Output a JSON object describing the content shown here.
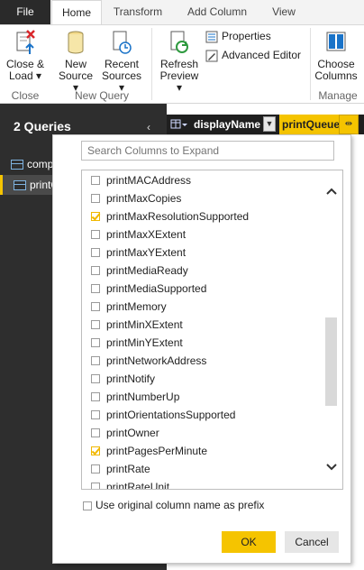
{
  "tabs": [
    "File",
    "Home",
    "Transform",
    "Add Column",
    "View"
  ],
  "ribbon": {
    "close_load": "Close &",
    "close_load2": "Load",
    "new_source": "New",
    "new_source2": "Source",
    "recent_sources": "Recent",
    "recent_sources2": "Sources",
    "refresh_preview": "Refresh",
    "refresh_preview2": "Preview",
    "properties": "Properties",
    "advanced_editor": "Advanced Editor",
    "choose_columns": "Choose",
    "choose_columns2": "Columns",
    "group_close": "Close",
    "group_new_query": "New Query",
    "group_manage": "Manage"
  },
  "queries": {
    "title": "2 Queries",
    "items": [
      "comp",
      "printQ"
    ]
  },
  "columns": {
    "display_name": "displayName",
    "print_queue": "printQueue"
  },
  "expand_panel": {
    "search_placeholder": "Search Columns to Expand",
    "items": [
      {
        "label": "printMACAddress",
        "checked": false
      },
      {
        "label": "printMaxCopies",
        "checked": false
      },
      {
        "label": "printMaxResolutionSupported",
        "checked": true
      },
      {
        "label": "printMaxXExtent",
        "checked": false
      },
      {
        "label": "printMaxYExtent",
        "checked": false
      },
      {
        "label": "printMediaReady",
        "checked": false
      },
      {
        "label": "printMediaSupported",
        "checked": false
      },
      {
        "label": "printMemory",
        "checked": false
      },
      {
        "label": "printMinXExtent",
        "checked": false
      },
      {
        "label": "printMinYExtent",
        "checked": false
      },
      {
        "label": "printNetworkAddress",
        "checked": false
      },
      {
        "label": "printNotify",
        "checked": false
      },
      {
        "label": "printNumberUp",
        "checked": false
      },
      {
        "label": "printOrientationsSupported",
        "checked": false
      },
      {
        "label": "printOwner",
        "checked": false
      },
      {
        "label": "printPagesPerMinute",
        "checked": true
      },
      {
        "label": "printRate",
        "checked": false
      },
      {
        "label": "printRateUnit",
        "checked": false
      }
    ],
    "prefix_label": "Use original column name as prefix",
    "prefix_checked": false,
    "ok": "OK",
    "cancel": "Cancel"
  },
  "colors": {
    "accent": "#f5c400",
    "file_tab": "#2a2a2a",
    "pane": "#2e2e2e"
  }
}
